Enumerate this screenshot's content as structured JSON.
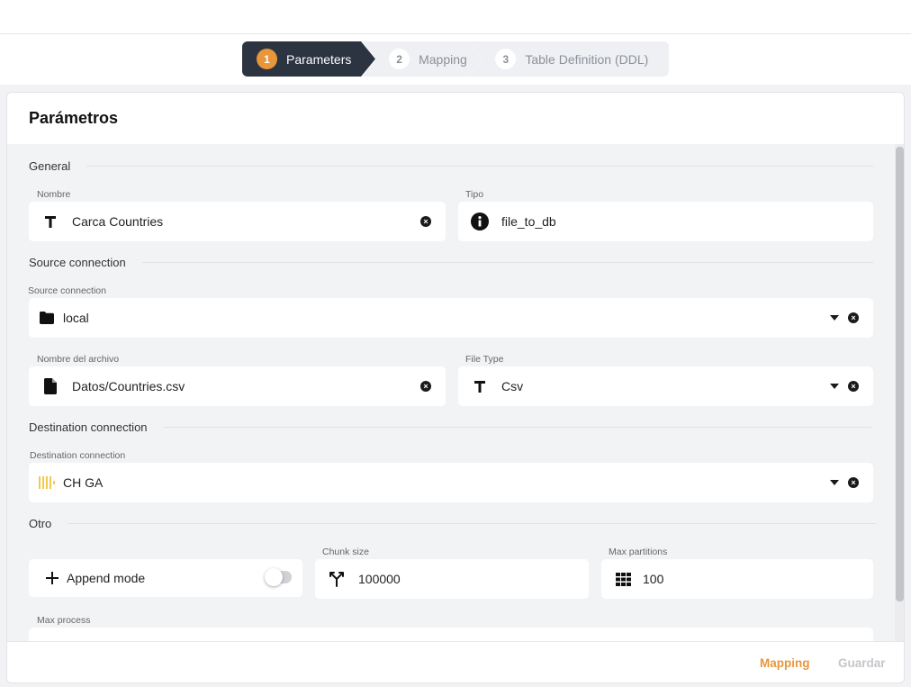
{
  "stepper": {
    "steps": [
      {
        "number": "1",
        "label": "Parameters"
      },
      {
        "number": "2",
        "label": "Mapping"
      },
      {
        "number": "3",
        "label": "Table Definition (DDL)"
      }
    ],
    "active_color": "#e8963a"
  },
  "card": {
    "title": "Parámetros"
  },
  "sections": {
    "general": "General",
    "source": "Source connection",
    "destination": "Destination connection",
    "other": "Otro"
  },
  "fields": {
    "nombre": {
      "label": "Nombre",
      "value": "Carca Countries",
      "icon": "text-icon"
    },
    "tipo": {
      "label": "Tipo",
      "value": "file_to_db",
      "icon": "info-icon"
    },
    "source_connection": {
      "label": "Source connection",
      "value": "local",
      "icon": "folder-icon"
    },
    "nombre_archivo": {
      "label": "Nombre del archivo",
      "value": "Datos/Countries.csv",
      "icon": "file-icon"
    },
    "file_type": {
      "label": "File Type",
      "value": "Csv",
      "icon": "text-icon"
    },
    "destination_connection": {
      "label": "Destination connection",
      "value": "CH GA",
      "icon": "clickhouse-icon"
    },
    "append_mode": {
      "label": "Append mode",
      "enabled": false,
      "icon": "plus-icon"
    },
    "chunk_size": {
      "label": "Chunk size",
      "value": "100000",
      "icon": "split-icon"
    },
    "max_partitions": {
      "label": "Max partitions",
      "value": "100",
      "icon": "grid-icon"
    },
    "max_process": {
      "label": "Max process"
    }
  },
  "footer": {
    "mapping_label": "Mapping",
    "guardar_label": "Guardar",
    "mapping_color": "#e8963a",
    "guardar_color": "#c4c6ca"
  }
}
